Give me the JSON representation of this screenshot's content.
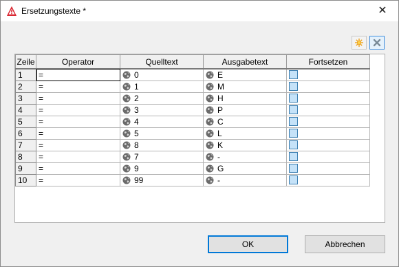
{
  "window": {
    "title": "Ersetzungstexte *",
    "close_glyph": "✕"
  },
  "toolbar": {
    "new_icon": "sun-new-icon",
    "delete_icon": "close-x-icon"
  },
  "grid": {
    "columns": [
      "Zeile",
      "Operator",
      "Quelltext",
      "Ausgabetext",
      "Fortsetzen"
    ],
    "rows": [
      {
        "zeile": "1",
        "operator": "=",
        "quelltext": "0",
        "ausgabetext": "E",
        "fortsetzen": false
      },
      {
        "zeile": "2",
        "operator": "=",
        "quelltext": "1",
        "ausgabetext": "M",
        "fortsetzen": false
      },
      {
        "zeile": "3",
        "operator": "=",
        "quelltext": "2",
        "ausgabetext": "H",
        "fortsetzen": false
      },
      {
        "zeile": "4",
        "operator": "=",
        "quelltext": "3",
        "ausgabetext": "P",
        "fortsetzen": false
      },
      {
        "zeile": "5",
        "operator": "=",
        "quelltext": "4",
        "ausgabetext": "C",
        "fortsetzen": false
      },
      {
        "zeile": "6",
        "operator": "=",
        "quelltext": "5",
        "ausgabetext": "L",
        "fortsetzen": false
      },
      {
        "zeile": "7",
        "operator": "=",
        "quelltext": "8",
        "ausgabetext": "K",
        "fortsetzen": false
      },
      {
        "zeile": "8",
        "operator": "=",
        "quelltext": "7",
        "ausgabetext": "-",
        "fortsetzen": false
      },
      {
        "zeile": "9",
        "operator": "=",
        "quelltext": "9",
        "ausgabetext": "G",
        "fortsetzen": false
      },
      {
        "zeile": "10",
        "operator": "=",
        "quelltext": "99",
        "ausgabetext": "-",
        "fortsetzen": false
      }
    ]
  },
  "buttons": {
    "ok": "OK",
    "cancel": "Abbrechen"
  }
}
